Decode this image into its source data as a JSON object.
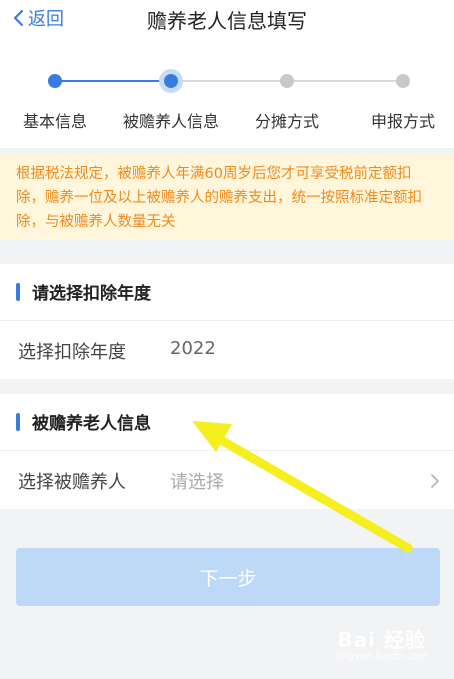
{
  "header": {
    "back_label": "返回",
    "title": "赡养老人信息填写"
  },
  "steps": [
    {
      "label": "基本信息",
      "state": "done"
    },
    {
      "label": "被赡养人信息",
      "state": "current"
    },
    {
      "label": "分摊方式",
      "state": "pending"
    },
    {
      "label": "申报方式",
      "state": "pending"
    }
  ],
  "notice": {
    "text": "根据税法规定，被赡养人年满60周岁后您才可享受税前定额扣除，赡养一位及以上被赡养人的赡养支出，统一按照标准定额扣除，与被赡养人数量无关"
  },
  "deduction_year": {
    "section_title": "请选择扣除年度",
    "field_label": "选择扣除年度",
    "field_value": "2022"
  },
  "dependent_info": {
    "section_title": "被赡养老人信息",
    "field_label": "选择被赡养人",
    "placeholder": "请选择"
  },
  "next_button": {
    "label": "下一步"
  },
  "watermark": {
    "text": "Bai 经验",
    "sub": "jingyan.baidu.com"
  },
  "colors": {
    "accent": "#3a7be0",
    "notice_bg": "#fff6db",
    "notice_text": "#f08a1c",
    "disabled_button": "#bed8f7",
    "annotation_arrow": "#f5ef1f"
  }
}
